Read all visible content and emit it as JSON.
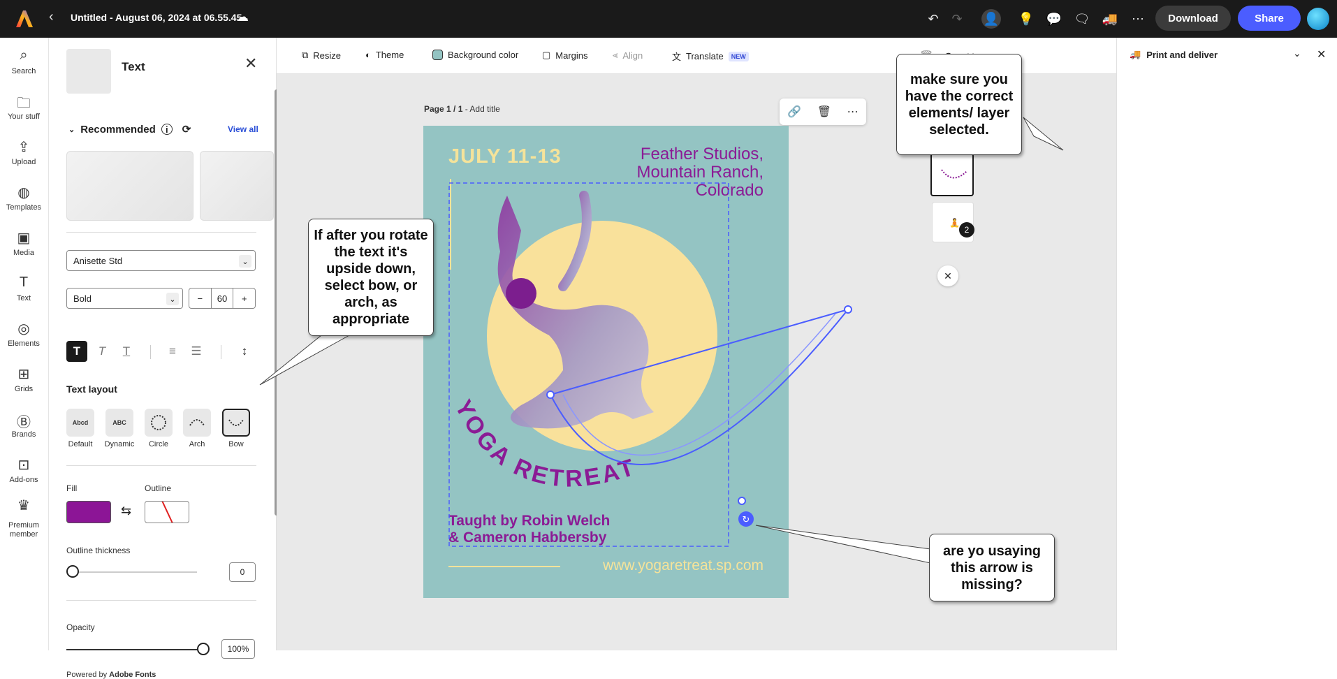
{
  "topbar": {
    "doc_title": "Untitled - August 06, 2024 at 06.55.45",
    "download_label": "Download",
    "share_label": "Share"
  },
  "rail": {
    "items": [
      {
        "label": "Search",
        "icon": "search-icon"
      },
      {
        "label": "Your stuff",
        "icon": "folder-icon"
      },
      {
        "label": "Upload",
        "icon": "upload-icon"
      },
      {
        "label": "Templates",
        "icon": "templates-icon"
      },
      {
        "label": "Media",
        "icon": "media-icon"
      },
      {
        "label": "Text",
        "icon": "text-icon"
      },
      {
        "label": "Elements",
        "icon": "elements-icon"
      },
      {
        "label": "Grids",
        "icon": "grids-icon"
      },
      {
        "label": "Brands",
        "icon": "brands-icon"
      },
      {
        "label": "Add-ons",
        "icon": "addons-icon"
      },
      {
        "label": "Premium member",
        "icon": "crown-icon"
      }
    ]
  },
  "panel": {
    "title": "Text",
    "recommended_label": "Recommended",
    "view_all": "View all",
    "font_family": "Anisette Std",
    "font_weight": "Bold",
    "font_size": "60",
    "text_layout_label": "Text layout",
    "layouts": [
      {
        "label": "Default",
        "preview": "Abcd"
      },
      {
        "label": "Dynamic",
        "preview": "ABC"
      },
      {
        "label": "Circle",
        "preview": ""
      },
      {
        "label": "Arch",
        "preview": ""
      },
      {
        "label": "Bow",
        "preview": ""
      }
    ],
    "selected_layout": "Bow",
    "fill_label": "Fill",
    "outline_label": "Outline",
    "fill_color": "#8c1596",
    "outline_thickness_label": "Outline thickness",
    "outline_thickness": "0",
    "opacity_label": "Opacity",
    "opacity": "100%",
    "powered_by": "Powered by",
    "powered_brand": "Adobe Fonts"
  },
  "subbar": {
    "resize": "Resize",
    "theme": "Theme",
    "background_color": "Background color",
    "margins": "Margins",
    "align": "Align",
    "translate": "Translate",
    "new_badge": "NEW",
    "add": "Add"
  },
  "page": {
    "label": "Page 1 / 1",
    "add_title": "Add title"
  },
  "poster": {
    "date": "JULY 11-13",
    "location_line1": "Feather Studios,",
    "location_line2": "Mountain Ranch,",
    "location_line3": "Colorado",
    "arc_text": "YOGA RETREAT",
    "taught_line1": "Taught by Robin Welch",
    "taught_line2": "& Cameron Habbersby",
    "url": "www.yogaretreat.sp.com",
    "bg_color": "#94c4c3",
    "accent_purple": "#8b1b95",
    "accent_yellow": "#f5e39a"
  },
  "thumbs": {
    "badge_count": "2"
  },
  "callouts": {
    "c1": "If after you rotate the text it's upside down, select bow, or arch, as appropriate",
    "c2": "make sure you have the correct elements/ layer selected.",
    "c3": "are yo usaying this arrow is missing?"
  },
  "right_panel": {
    "title": "Print and deliver"
  }
}
